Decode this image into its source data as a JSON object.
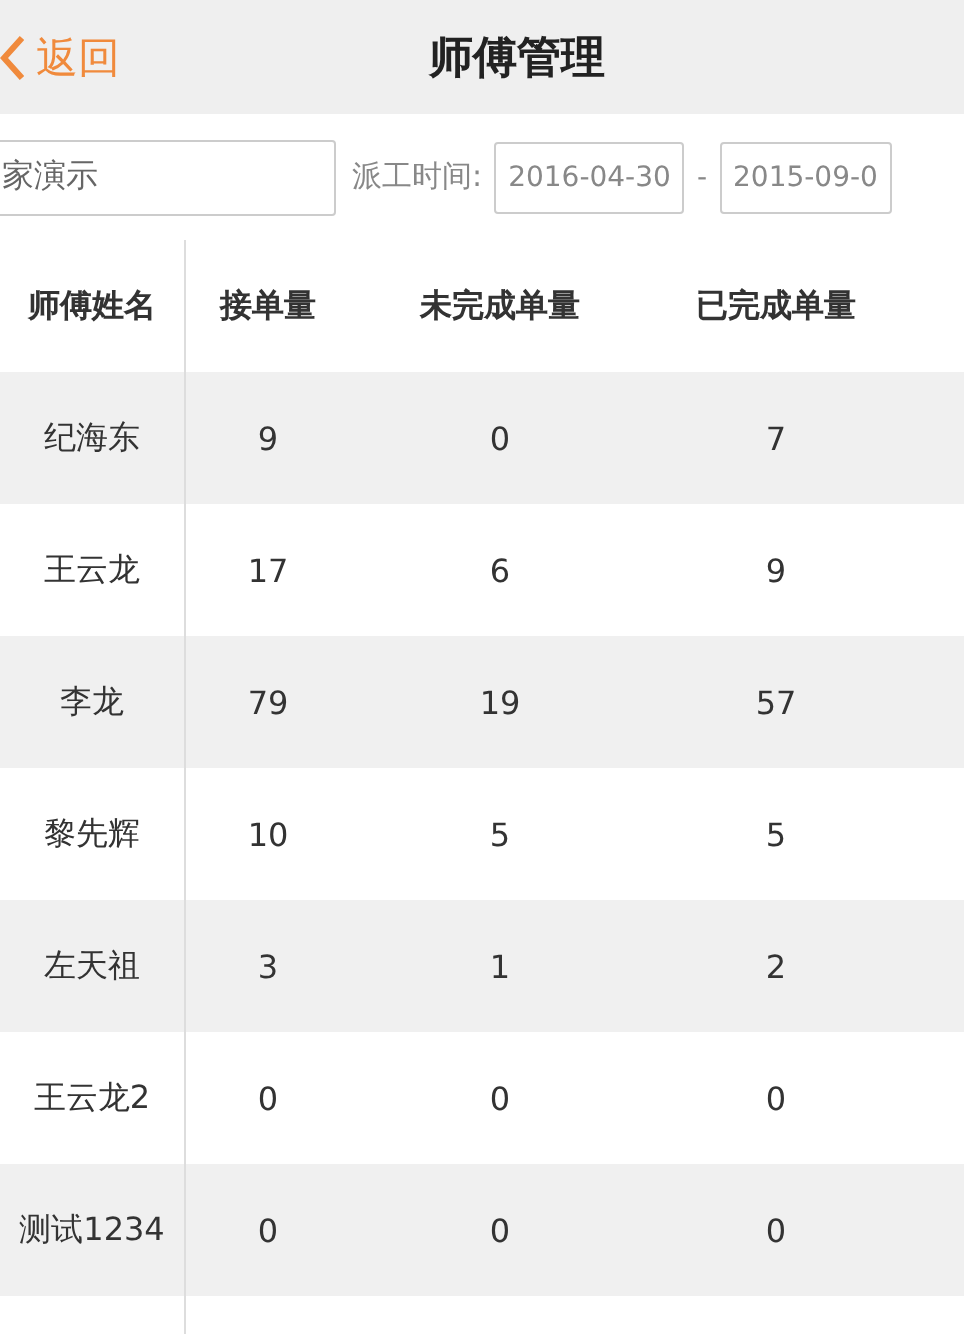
{
  "nav": {
    "back": "返回",
    "title": "师傅管理"
  },
  "filter": {
    "search_value": "家演示",
    "date_label": "派工时间:",
    "date_from": "2016-04-30",
    "separator": "-",
    "date_to": "2015-09-0"
  },
  "table": {
    "columns": [
      "师傅姓名",
      "接单量",
      "未完成单量",
      "已完成单量"
    ],
    "rows": [
      [
        "纪海东",
        "9",
        "0",
        "7"
      ],
      [
        "王云龙",
        "17",
        "6",
        "9"
      ],
      [
        "李龙",
        "79",
        "19",
        "57"
      ],
      [
        "黎先辉",
        "10",
        "5",
        "5"
      ],
      [
        "左天祖",
        "3",
        "1",
        "2"
      ],
      [
        "王云龙2",
        "0",
        "0",
        "0"
      ],
      [
        "测试1234",
        "0",
        "0",
        "0"
      ]
    ]
  }
}
